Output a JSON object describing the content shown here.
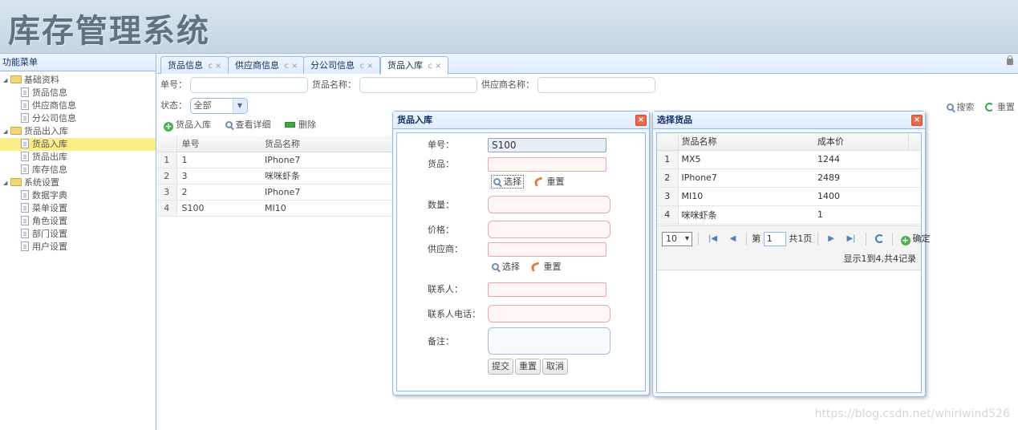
{
  "header": {
    "title": "库存管理系统"
  },
  "west": {
    "title": "功能菜单",
    "groups": [
      {
        "label": "基础资料",
        "items": [
          "货品信息",
          "供应商信息",
          "分公司信息"
        ]
      },
      {
        "label": "货品出入库",
        "items": [
          "货品入库",
          "货品出库",
          "库存信息"
        ]
      },
      {
        "label": "系统设置",
        "items": [
          "数据字典",
          "菜单设置",
          "角色设置",
          "部门设置",
          "用户设置"
        ]
      }
    ],
    "selected": "货品入库"
  },
  "tabs": [
    {
      "label": "货品信息"
    },
    {
      "label": "供应商信息"
    },
    {
      "label": "分公司信息"
    },
    {
      "label": "货品入库"
    }
  ],
  "tab_refresh": "c",
  "tab_close": "×",
  "search": {
    "no_label": "单号：",
    "name_label": "货品名称：",
    "supplier_label": "供应商名称：",
    "status_label": "状态：",
    "status_value": "全部",
    "search_btn": "搜索",
    "reset_btn": "重置"
  },
  "toolbar": {
    "add": "货品入库",
    "detail": "查看详细",
    "delete": "删除"
  },
  "grid": {
    "columns": [
      "单号",
      "货品名称"
    ],
    "rows": [
      {
        "rn": "1",
        "no": "1",
        "name": "IPhone7"
      },
      {
        "rn": "2",
        "no": "3",
        "name": "咪咪虾条"
      },
      {
        "rn": "3",
        "no": "2",
        "name": "IPhone7"
      },
      {
        "rn": "4",
        "no": "S100",
        "name": "MI10"
      }
    ]
  },
  "dialog_in": {
    "title": "货品入库",
    "fields": {
      "no": "单号：",
      "no_value": "S100",
      "goods": "货品：",
      "qty": "数量：",
      "price": "价格：",
      "supplier": "供应商：",
      "contact": "联系人：",
      "phone": "联系人电话：",
      "remark": "备注："
    },
    "choose": "选择",
    "reset": "重置",
    "submit": "提交",
    "reset_btn": "重置",
    "cancel": "取消"
  },
  "dialog_pick": {
    "title": "选择货品",
    "columns": [
      "货品名称",
      "成本价"
    ],
    "rows": [
      {
        "rn": "1",
        "name": "MX5",
        "cost": "1244"
      },
      {
        "rn": "2",
        "name": "IPhone7",
        "cost": "2489"
      },
      {
        "rn": "3",
        "name": "MI10",
        "cost": "1400"
      },
      {
        "rn": "4",
        "name": "咪咪虾条",
        "cost": "1"
      }
    ],
    "pager": {
      "page_size": "10",
      "page_label": "第",
      "page_value": "1",
      "total_pages": "共1页",
      "confirm": "确定",
      "info": "显示1到4,共4记录"
    }
  },
  "watermark": "https://blog.csdn.net/whirlwind526"
}
